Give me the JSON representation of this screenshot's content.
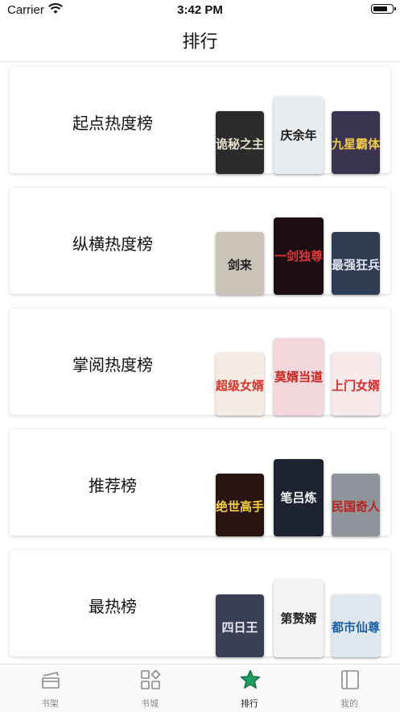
{
  "status_bar": {
    "carrier": "Carrier",
    "time": "3:42 PM"
  },
  "nav": {
    "title": "排行"
  },
  "rankings": [
    {
      "title": "起点热度榜",
      "covers": [
        {
          "text": "诡秘之主",
          "bg": "#2b2b2b",
          "fg": "#e8e0d0"
        },
        {
          "text": "庆余年",
          "bg": "#e9ecef",
          "fg": "#1b1b1b"
        },
        {
          "text": "九星霸体",
          "bg": "#3b3450",
          "fg": "#f2c84b"
        }
      ]
    },
    {
      "title": "纵横热度榜",
      "covers": [
        {
          "text": "剑来",
          "bg": "#c9c3b8",
          "fg": "#1f1f1f"
        },
        {
          "text": "一剑独尊",
          "bg": "#1c0e12",
          "fg": "#d63a3a"
        },
        {
          "text": "最强狂兵",
          "bg": "#2f3d52",
          "fg": "#e0e6ef"
        }
      ]
    },
    {
      "title": "掌阅热度榜",
      "covers": [
        {
          "text": "超级女婿",
          "bg": "#f6ece4",
          "fg": "#d9342b"
        },
        {
          "text": "莫婿当道",
          "bg": "#f3d7dc",
          "fg": "#c8231d"
        },
        {
          "text": "上门女婿",
          "bg": "#f8eaea",
          "fg": "#d82b2b"
        }
      ]
    },
    {
      "title": "推荐榜",
      "covers": [
        {
          "text": "绝世高手",
          "bg": "#2a1410",
          "fg": "#f5d142"
        },
        {
          "text": "笔吕炼",
          "bg": "#1d2330",
          "fg": "#f0f0f0"
        },
        {
          "text": "民国奇人",
          "bg": "#8e9499",
          "fg": "#b8231c"
        }
      ]
    },
    {
      "title": "最热榜",
      "covers": [
        {
          "text": "四日王",
          "bg": "#3a3f55",
          "fg": "#e8ecf5"
        },
        {
          "text": "第赘婿",
          "bg": "#f4f4f4",
          "fg": "#222222"
        },
        {
          "text": "都市仙尊",
          "bg": "#dfe8ef",
          "fg": "#1a5fa8"
        }
      ]
    }
  ],
  "tabs": [
    {
      "label": "书架",
      "icon": "bookshelf-icon",
      "active": false
    },
    {
      "label": "书城",
      "icon": "bookstore-grid-icon",
      "active": false
    },
    {
      "label": "排行",
      "icon": "star-icon",
      "active": true
    },
    {
      "label": "我的",
      "icon": "profile-book-icon",
      "active": false
    }
  ],
  "colors": {
    "accent_green": "#1fa060",
    "tab_inactive": "#888888"
  }
}
